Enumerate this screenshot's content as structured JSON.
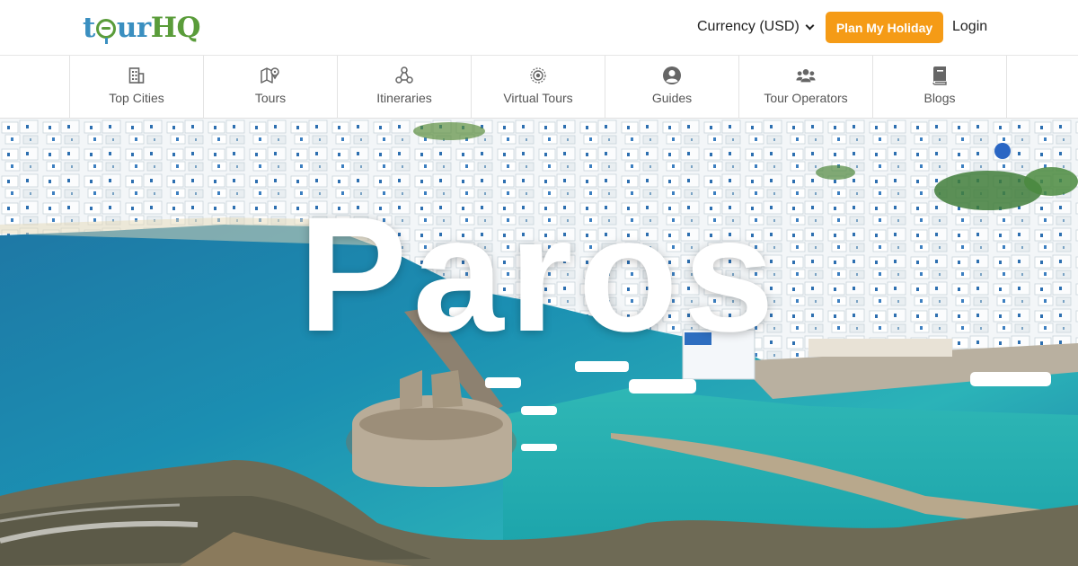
{
  "header": {
    "logo": {
      "part1": "t",
      "part2": "ur",
      "part3": "HQ"
    },
    "currency_label": "Currency (USD)",
    "plan_button": "Plan My Holiday",
    "login": "Login"
  },
  "nav": {
    "items": [
      {
        "label": "Top Cities",
        "icon": "building-icon"
      },
      {
        "label": "Tours",
        "icon": "map-pin-icon"
      },
      {
        "label": "Itineraries",
        "icon": "route-icon"
      },
      {
        "label": "Virtual Tours",
        "icon": "virtual-tour-icon"
      },
      {
        "label": "Guides",
        "icon": "user-circle-icon"
      },
      {
        "label": "Tour Operators",
        "icon": "users-icon"
      },
      {
        "label": "Blogs",
        "icon": "book-icon"
      }
    ]
  },
  "hero": {
    "title": "Paros"
  },
  "colors": {
    "accent": "#f59b16",
    "logo_blue": "#3a8fc0",
    "logo_green": "#5a9c3a"
  }
}
